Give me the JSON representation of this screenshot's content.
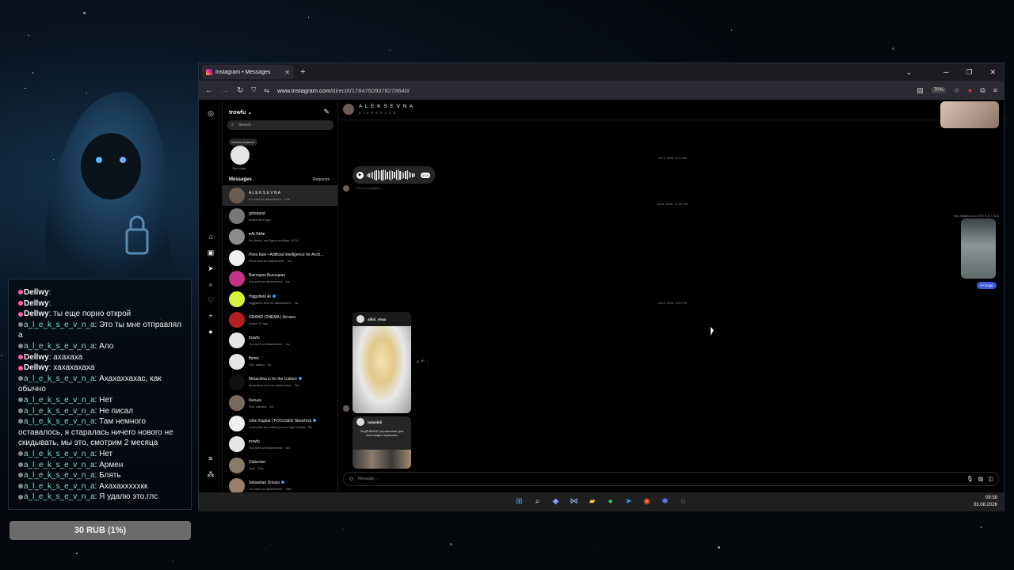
{
  "stream_overlay": {
    "chat": [
      {
        "user": "Dellwy",
        "text": "",
        "kind": "d"
      },
      {
        "user": "Dellwy",
        "text": "",
        "kind": "d"
      },
      {
        "user": "Dellwy",
        "text": "ты еще порно открой",
        "kind": "d"
      },
      {
        "user": "a_l_e_k_s_e_v_n_a",
        "text": "Это ты мне отправлял а",
        "kind": "a"
      },
      {
        "user": "a_l_e_k_s_e_v_n_a",
        "text": "Ало",
        "kind": "a"
      },
      {
        "user": "Dellwy",
        "text": "ахахаха",
        "kind": "d"
      },
      {
        "user": "Dellwy",
        "text": "хахахахаха",
        "kind": "d"
      },
      {
        "user": "a_l_e_k_s_e_v_n_a",
        "text": "Ахахаххахас, как обычно",
        "kind": "a"
      },
      {
        "user": "a_l_e_k_s_e_v_n_a",
        "text": "Нет",
        "kind": "a"
      },
      {
        "user": "a_l_e_k_s_e_v_n_a",
        "text": "Не писал",
        "kind": "a"
      },
      {
        "user": "a_l_e_k_s_e_v_n_a",
        "text": "Там немного оставалось, я старалась ничего нового не скидывать, мы это, смотрим 2 месяца",
        "kind": "a"
      },
      {
        "user": "a_l_e_k_s_e_v_n_a",
        "text": "Нет",
        "kind": "a"
      },
      {
        "user": "a_l_e_k_s_e_v_n_a",
        "text": "Армен",
        "kind": "a"
      },
      {
        "user": "a_l_e_k_s_e_v_n_a",
        "text": "Блять",
        "kind": "a"
      },
      {
        "user": "a_l_e_k_s_e_v_n_a",
        "text": "Ахахахххххкк",
        "kind": "a"
      },
      {
        "user": "a_l_e_k_s_e_v_n_a",
        "text": "Я удалю это.глс",
        "kind": "a"
      }
    ],
    "donation_goal": "30 RUB (1%)"
  },
  "browser": {
    "tab_title": "Instagram • Messages",
    "url_host": "www.instagram.com",
    "url_path": "/direct/t/17847609378278640/",
    "zoom": "70%"
  },
  "inbox": {
    "username": "trowfu",
    "search_placeholder": "Search",
    "note_bubble": "Weekend plans?",
    "note_label": "Your note",
    "messages_label": "Messages",
    "requests_label": "Requests",
    "conversations": [
      {
        "name": "A L E K S E V N A",
        "sub": "A L sent an attachment. · 10h",
        "color": "#6b5b52",
        "verified": false
      },
      {
        "name": "gofsdand",
        "sub": "Active 59m ago",
        "color": "#777777",
        "verified": false
      },
      {
        "name": "♥ALINA♥",
        "sub": "Вы иметь как будто вообще 18 24",
        "color": "#8d8d8d",
        "verified": false
      },
      {
        "name": "Pires Italo • Artificial Intelligence for Archi...",
        "sub": "Pires sent an attachment. · 1w",
        "color": "#f0f0f0",
        "verified": false
      },
      {
        "name": "Виктория Высоцкая",
        "sub": "You sent an attachment. · 1w",
        "color": "#c13584",
        "verified": false
      },
      {
        "name": "Higgsfield AI",
        "sub": "Higgsfield sent an attachment. · 1w",
        "color": "#d4f53c",
        "verified": true
      },
      {
        "name": "GRAND CINEMA | Астана",
        "sub": "Active 7h ago",
        "color": "#b3201f",
        "verified": false
      },
      {
        "name": "trqwfu",
        "sub": "You sent an attachment. · 2w",
        "color": "#e6e6e6",
        "verified": false
      },
      {
        "name": "fbimic",
        "sub": "You: капец · 2w",
        "color": "#e6e6e6",
        "verified": false
      },
      {
        "name": "Metaclima is for the Culture",
        "sub": "Metaclima sent an attachment. · 2w",
        "color": "#111111",
        "verified": true
      },
      {
        "name": "Каська",
        "sub": "You: hahaha · 2w",
        "color": "#7a6a60",
        "verified": false
      },
      {
        "name": "John Kapilar | FOCUSED SketchUp",
        "sub": "Looks like the training is not right for this · 5w",
        "color": "#f0f0f0",
        "verified": true
      },
      {
        "name": "trowfu",
        "sub": "You sent an attachment. · 6w",
        "color": "#e6e6e6",
        "verified": false
      },
      {
        "name": "Dietscher",
        "sub": "Yes! · 23w",
        "color": "#8a7a6a",
        "verified": false
      },
      {
        "name": "Sebastian Drivasi",
        "sub": "You sent an attachment. · 28w",
        "color": "#9a7f6f",
        "verified": true
      }
    ]
  },
  "thread": {
    "name": "A L E K S E V N A",
    "handle": "a l e k s e v n a",
    "timestamps": [
      "Jul 4, 2026, 8:11 AM",
      "Jul 4, 2026, 12:29 PM",
      "Jul 4, 2026, 3:01 PM"
    ],
    "voice_duration": "0:03",
    "voice_sub": "View transcription",
    "replied_label": "You replied to A L E K S E V N A",
    "reply_text": "отсосда",
    "reel1_user": "alibii_shaa",
    "reel2_user": "tadasbiii",
    "reel2_caption": "НАДЁЖНОЕ упражнение для настоящего мужчины",
    "composer_placeholder": "Message..."
  },
  "taskbar": {
    "time": "09:58",
    "date": "03.08.2026"
  }
}
